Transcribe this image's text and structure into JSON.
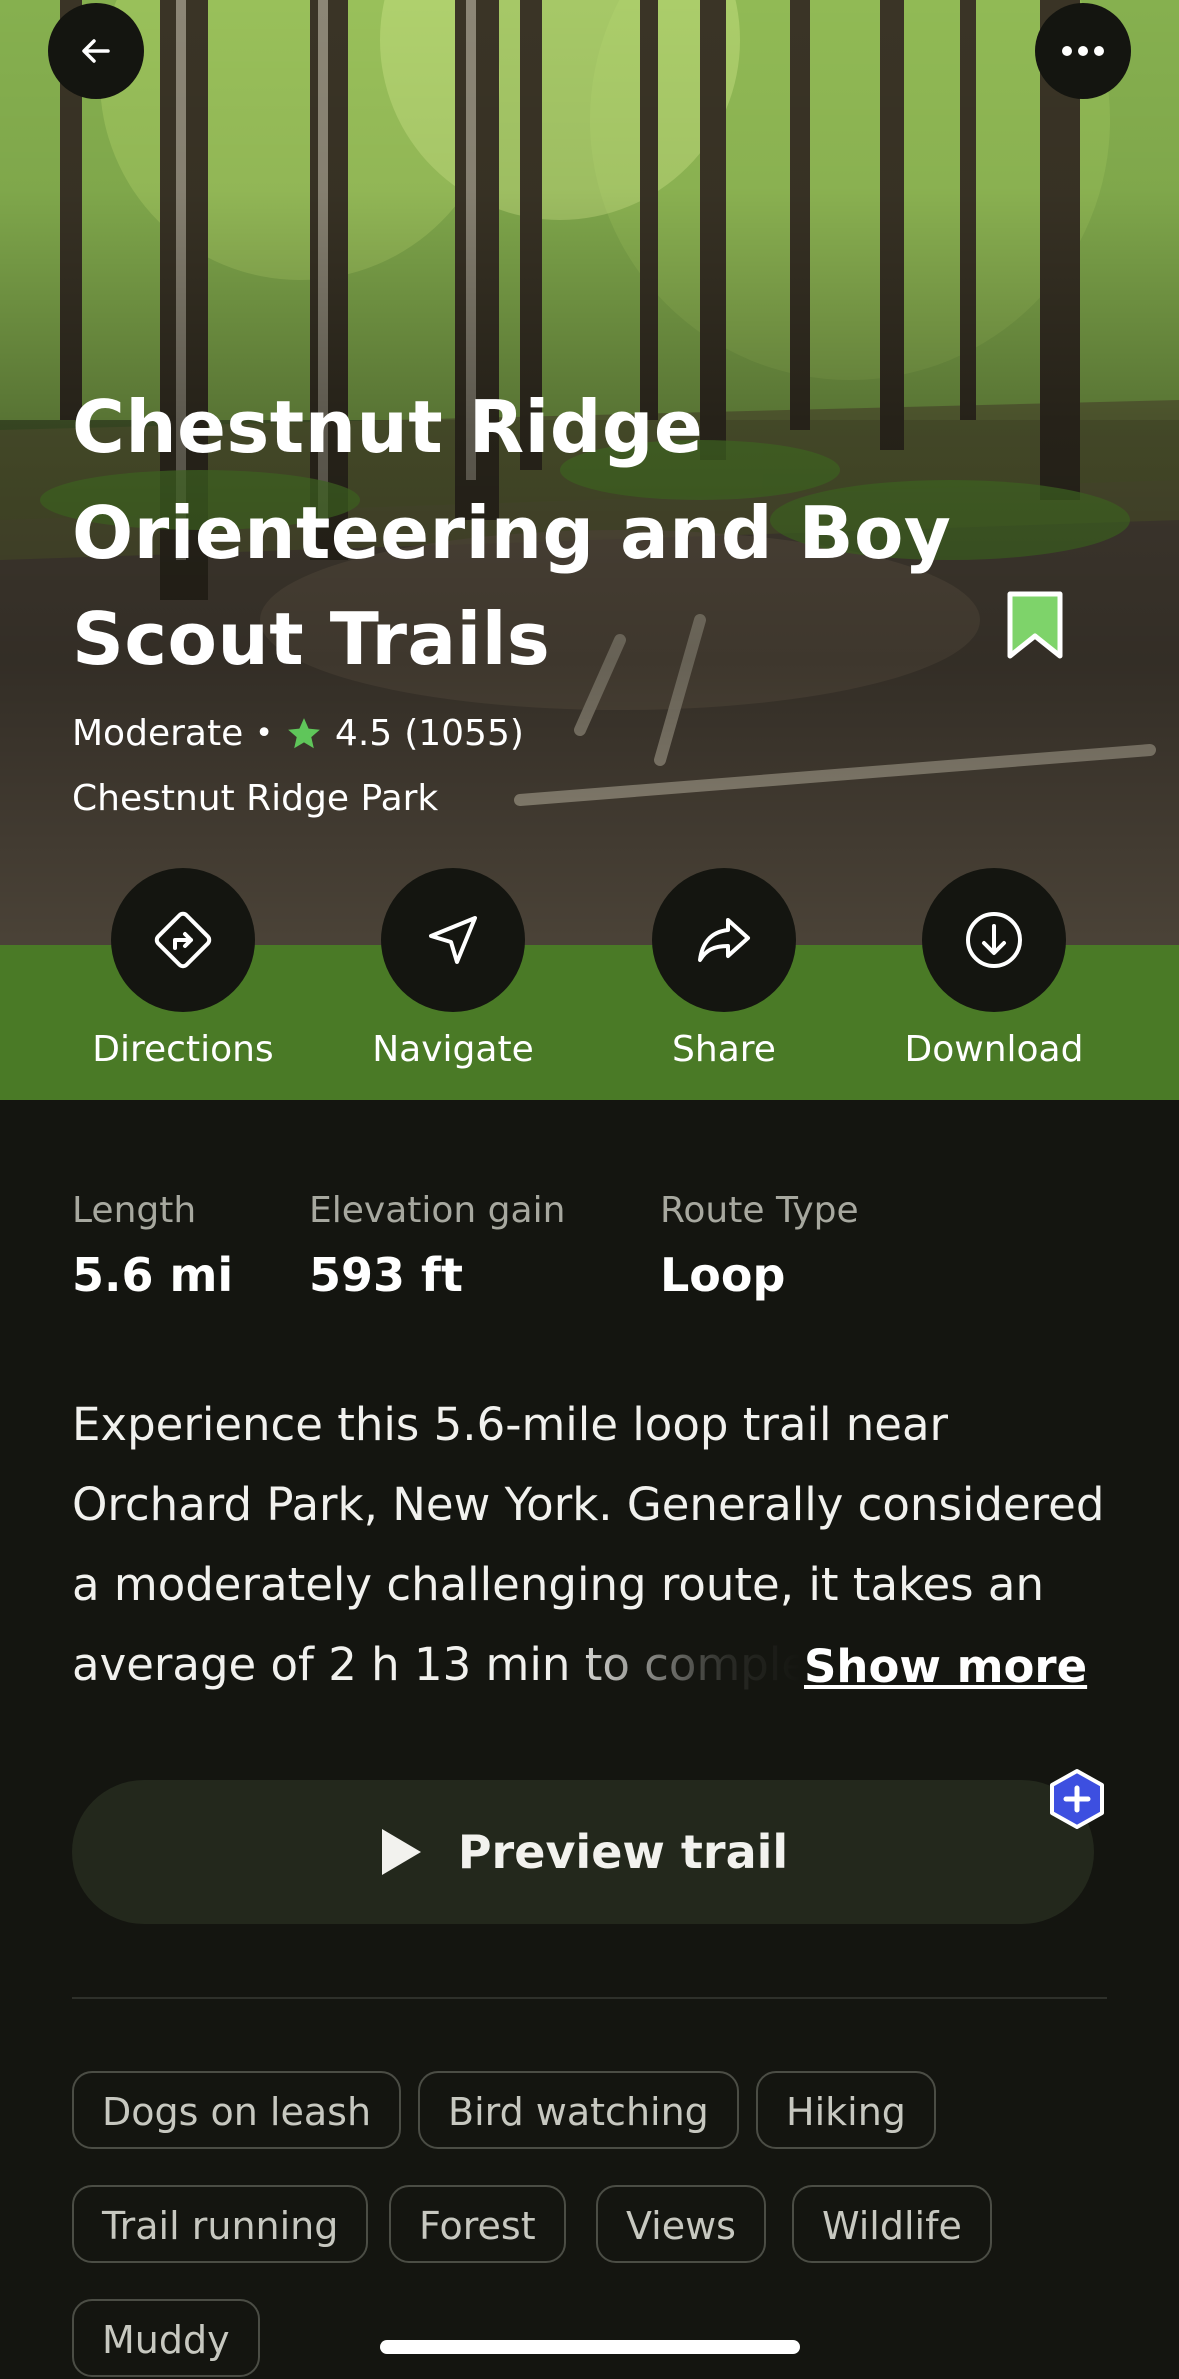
{
  "trail": {
    "name": "Chestnut Ridge Orienteering and Boy Scout Trails",
    "difficulty": "Moderate",
    "rating": "4.5",
    "review_count": "(1055)",
    "park": "Chestnut Ridge Park"
  },
  "actions": {
    "directions": "Directions",
    "navigate": "Navigate",
    "share": "Share",
    "download": "Download"
  },
  "stats": {
    "length_label": "Length",
    "length_value": "5.6 mi",
    "elevation_label": "Elevation gain",
    "elevation_value": "593 ft",
    "route_label": "Route Type",
    "route_value": "Loop"
  },
  "description": {
    "text": "Experience this 5.6-mile loop trail near Orchard Park, New York. Generally considered a moderately challenging route, it takes an average of 2 h 13 min to complete. This is",
    "show_more": "Show more"
  },
  "preview": {
    "label": "Preview trail"
  },
  "tags": [
    "Dogs on leash",
    "Bird watching",
    "Hiking",
    "Trail running",
    "Forest",
    "Views",
    "Wildlife",
    "Muddy"
  ],
  "colors": {
    "background": "#141510",
    "accent_green": "#4a7a26",
    "star": "#5fc65a",
    "bookmark": "#7ed36a",
    "badge": "#3d4fe0"
  }
}
